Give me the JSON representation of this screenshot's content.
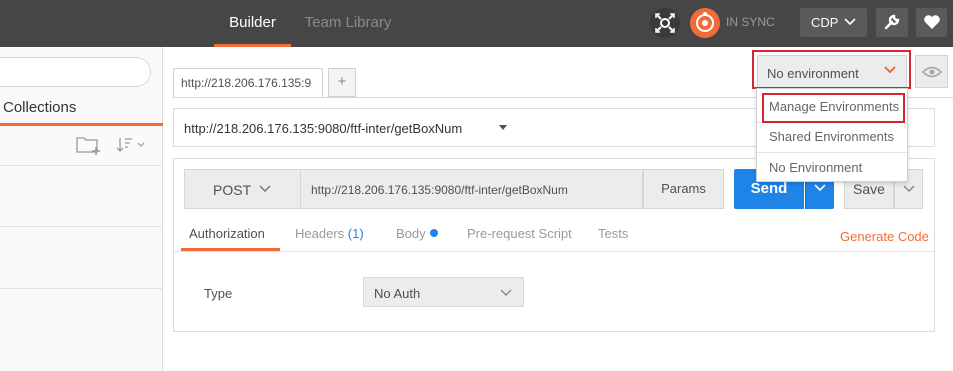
{
  "topbar": {
    "tab_builder": "Builder",
    "tab_team_library": "Team Library",
    "sync_status": "IN SYNC",
    "workspace": "CDP",
    "colors": {
      "bar": "#464646",
      "accent": "#f26b3a"
    }
  },
  "sidebar": {
    "tab_collections": "Collections"
  },
  "request_tab": {
    "title": "http://218.206.176.135:9",
    "add_label": "+"
  },
  "environment": {
    "selected": "No environment",
    "menu": {
      "items": [
        "Manage Environments",
        "Shared Environments",
        "No Environment"
      ]
    }
  },
  "url_summary": "http://218.206.176.135:9080/ftf-inter/getBoxNum",
  "request": {
    "method": "POST",
    "url": "http://218.206.176.135:9080/ftf-inter/getBoxNum",
    "params_label": "Params",
    "send_label": "Send",
    "save_label": "Save",
    "send_color": "#1e84e7"
  },
  "subtabs": {
    "authorization": "Authorization",
    "headers": "Headers",
    "headers_count": "(1)",
    "body": "Body",
    "prerequest": "Pre-request Script",
    "tests": "Tests",
    "generate_code": "Generate Code"
  },
  "auth": {
    "type_label": "Type",
    "type_value": "No Auth"
  }
}
